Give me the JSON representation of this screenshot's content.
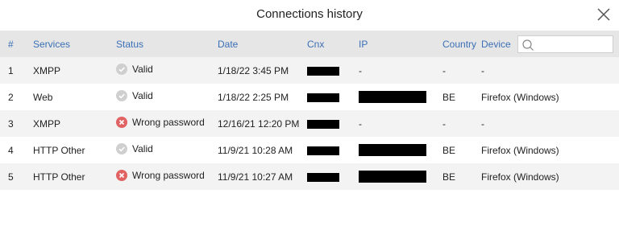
{
  "dialog": {
    "title": "Connections history",
    "close_icon": "close-icon"
  },
  "columns": {
    "num": "#",
    "services": "Services",
    "status": "Status",
    "date": "Date",
    "cnx": "Cnx",
    "ip": "IP",
    "country": "Country",
    "device": "Device"
  },
  "search": {
    "placeholder": "",
    "value": "",
    "icon": "search-icon"
  },
  "rows": [
    {
      "num": "1",
      "service": "XMPP",
      "status": "Valid",
      "status_type": "ok",
      "date": "1/18/22 3:45 PM",
      "cnx_redacted": true,
      "ip": "-",
      "ip_redacted": false,
      "country": "-",
      "device": "-"
    },
    {
      "num": "2",
      "service": "Web",
      "status": "Valid",
      "status_type": "ok",
      "date": "1/18/22 2:25 PM",
      "cnx_redacted": true,
      "ip": "",
      "ip_redacted": true,
      "country": "BE",
      "device": "Firefox (Windows)"
    },
    {
      "num": "3",
      "service": "XMPP",
      "status": "Wrong password",
      "status_type": "err",
      "date": "12/16/21 12:20 PM",
      "cnx_redacted": true,
      "ip": "-",
      "ip_redacted": false,
      "country": "-",
      "device": "-"
    },
    {
      "num": "4",
      "service": "HTTP Other",
      "status": "Valid",
      "status_type": "ok",
      "date": "11/9/21 10:28 AM",
      "cnx_redacted": true,
      "ip": "",
      "ip_redacted": true,
      "country": "BE",
      "device": "Firefox (Windows)"
    },
    {
      "num": "5",
      "service": "HTTP Other",
      "status": "Wrong password",
      "status_type": "err",
      "date": "11/9/21 10:27 AM",
      "cnx_redacted": true,
      "ip": "",
      "ip_redacted": true,
      "country": "BE",
      "device": "Firefox (Windows)"
    }
  ],
  "colors": {
    "header_bg": "#e6e6e6",
    "header_text": "#3b6fb6",
    "row_alt_bg": "#f3f3f3",
    "valid_icon": "#cfcfcf",
    "error_icon": "#e06262"
  }
}
